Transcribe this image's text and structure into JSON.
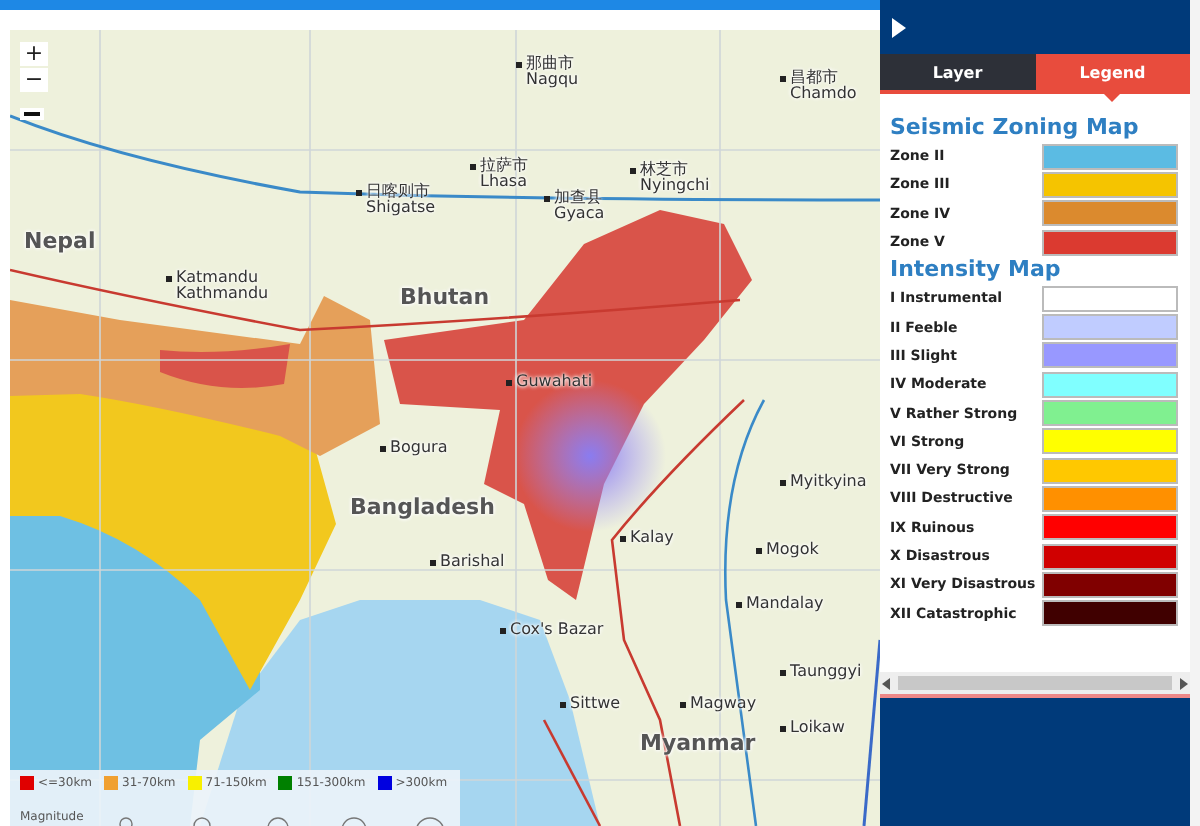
{
  "map": {
    "zoom_in": "+",
    "zoom_out": "−",
    "countries": [
      "Nepal",
      "Bhutan",
      "Bangladesh",
      "Myanmar"
    ],
    "cities": [
      {
        "native": "那曲市",
        "name": "Nagqu"
      },
      {
        "native": "昌都市",
        "name": "Chamdo"
      },
      {
        "native": "拉萨市",
        "name": "Lhasa"
      },
      {
        "native": "林芝市",
        "name": "Nyingchi"
      },
      {
        "native": "日喀则市",
        "name": "Shigatse"
      },
      {
        "native": "加查县",
        "name": "Gyaca"
      },
      {
        "native": "Katmandu",
        "name": "Kathmandu"
      },
      {
        "name": "Guwahati"
      },
      {
        "name": "Bogura"
      },
      {
        "name": "Myitkyina"
      },
      {
        "name": "Kalay"
      },
      {
        "name": "Barishal"
      },
      {
        "name": "Mogok"
      },
      {
        "name": "Mandalay"
      },
      {
        "name": "Cox's Bazar"
      },
      {
        "name": "Taunggyi"
      },
      {
        "name": "Sittwe"
      },
      {
        "name": "Magway"
      },
      {
        "name": "Loikaw"
      }
    ],
    "depth_legend": {
      "items": [
        {
          "label": "<=30km",
          "color": "#e00000"
        },
        {
          "label": "31-70km",
          "color": "#f0a030"
        },
        {
          "label": "71-150km",
          "color": "#f8f000"
        },
        {
          "label": "151-300km",
          "color": "#008000"
        },
        {
          "label": ">300km",
          "color": "#0000e0"
        }
      ],
      "magnitude_label": "Magnitude"
    }
  },
  "panel": {
    "tabs": [
      {
        "label": "Layer",
        "selected": false
      },
      {
        "label": "Legend",
        "selected": true
      }
    ],
    "sections": [
      {
        "title": "Seismic Zoning Map",
        "items": [
          {
            "label": "Zone II",
            "color": "#5bbbe3"
          },
          {
            "label": "Zone III",
            "color": "#f5c400"
          },
          {
            "label": "Zone IV",
            "color": "#db8a2e"
          },
          {
            "label": "Zone V",
            "color": "#db3a30"
          }
        ]
      },
      {
        "title": "Intensity Map",
        "items": [
          {
            "label": "I Instrumental",
            "color": "#ffffff"
          },
          {
            "label": "II Feeble",
            "color": "#c0ccff"
          },
          {
            "label": "III Slight",
            "color": "#9898ff"
          },
          {
            "label": "IV Moderate",
            "color": "#80ffff"
          },
          {
            "label": "V Rather Strong",
            "color": "#80f090"
          },
          {
            "label": "VI Strong",
            "color": "#ffff00"
          },
          {
            "label": "VII Very Strong",
            "color": "#ffc800"
          },
          {
            "label": "VIII Destructive",
            "color": "#ff9000"
          },
          {
            "label": "IX Ruinous",
            "color": "#ff0000"
          },
          {
            "label": "X Disastrous",
            "color": "#d00000"
          },
          {
            "label": "XI Very Disastrous",
            "color": "#800000"
          },
          {
            "label": "XII Catastrophic",
            "color": "#400000"
          }
        ]
      }
    ]
  }
}
